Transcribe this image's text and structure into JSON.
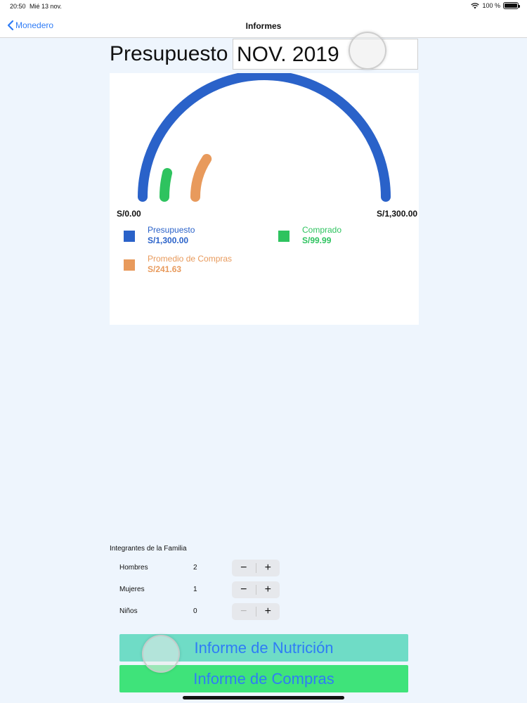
{
  "status": {
    "time": "20:50",
    "date": "Mié 13 nov.",
    "battery": "100 %"
  },
  "nav": {
    "back_label": "Monedero",
    "title": "Informes"
  },
  "budget": {
    "title": "Presupuesto",
    "month": "NOV. 2019"
  },
  "gauge": {
    "min_label": "S/0.00",
    "max_label": "S/1,300.00",
    "max": 1300,
    "comprado": 99.99,
    "promedio": 241.63,
    "colors": {
      "presupuesto": "#2a62c9",
      "comprado": "#2ec35f",
      "promedio": "#e89a5c"
    }
  },
  "legend": {
    "presupuesto": {
      "label": "Presupuesto",
      "value": "S/1,300.00"
    },
    "comprado": {
      "label": "Comprado",
      "value": "S/99.99"
    },
    "promedio": {
      "label": "Promedio de Compras",
      "value": "S/241.63"
    }
  },
  "family": {
    "title": "Integrantes de la Familia",
    "rows": [
      {
        "label": "Hombres",
        "count": "2"
      },
      {
        "label": "Mujeres",
        "count": "1"
      },
      {
        "label": "Niños",
        "count": "0"
      }
    ],
    "minus": "−",
    "plus": "+"
  },
  "buttons": {
    "nutricion": "Informe de Nutrición",
    "compras": "Informe de Compras",
    "nutricion_color": "#6fdcc6",
    "compras_color": "#3fe37a"
  }
}
